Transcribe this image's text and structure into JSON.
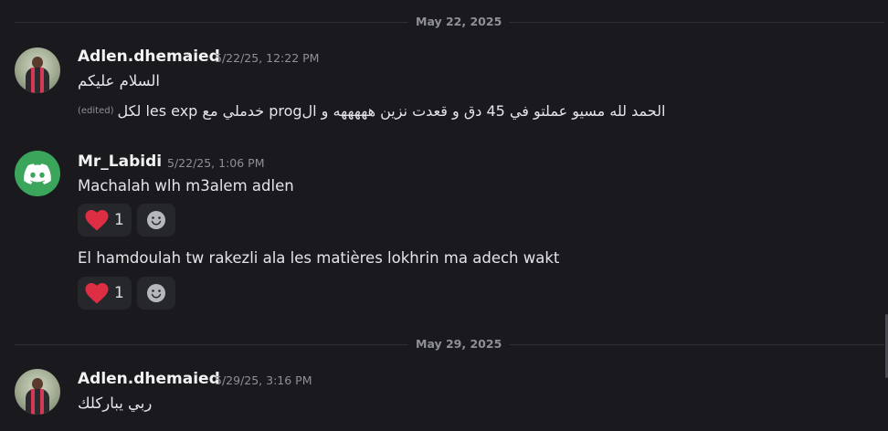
{
  "dividers": [
    {
      "label": "May 22, 2025"
    },
    {
      "label": "May 29, 2025"
    }
  ],
  "messages": [
    {
      "username": "Adlen.dhemaied",
      "timestamp": "5/22/25, 12:22 PM",
      "avatar": "profile-photo",
      "lines": [
        "السلام عليكم",
        "الحمد لله مسيو عملتو في 45 دق و قعدت نزين هههههه و الprog خدملي مع les exp لكل"
      ],
      "edited_label": "(edited)"
    },
    {
      "username": "Mr_Labidi",
      "timestamp": "5/22/25, 1:06 PM",
      "avatar": "discord-logo",
      "lines": [
        "Machalah wlh m3alem adlen",
        "El hamdoulah tw rakezli ala les matières lokhrin ma adech wakt"
      ],
      "reactions": [
        {
          "emoji": "heart-icon",
          "count": "1"
        },
        {
          "emoji": "heart-icon",
          "count": "1"
        }
      ]
    },
    {
      "username": "Adlen.dhemaied",
      "timestamp": "5/29/25, 3:16 PM",
      "avatar": "profile-photo",
      "lines": [
        "ربي يباركلك"
      ]
    }
  ],
  "colors": {
    "background": "#1a1a1e",
    "heart": "#dd2e44",
    "discord_green": "#3ba55c"
  }
}
